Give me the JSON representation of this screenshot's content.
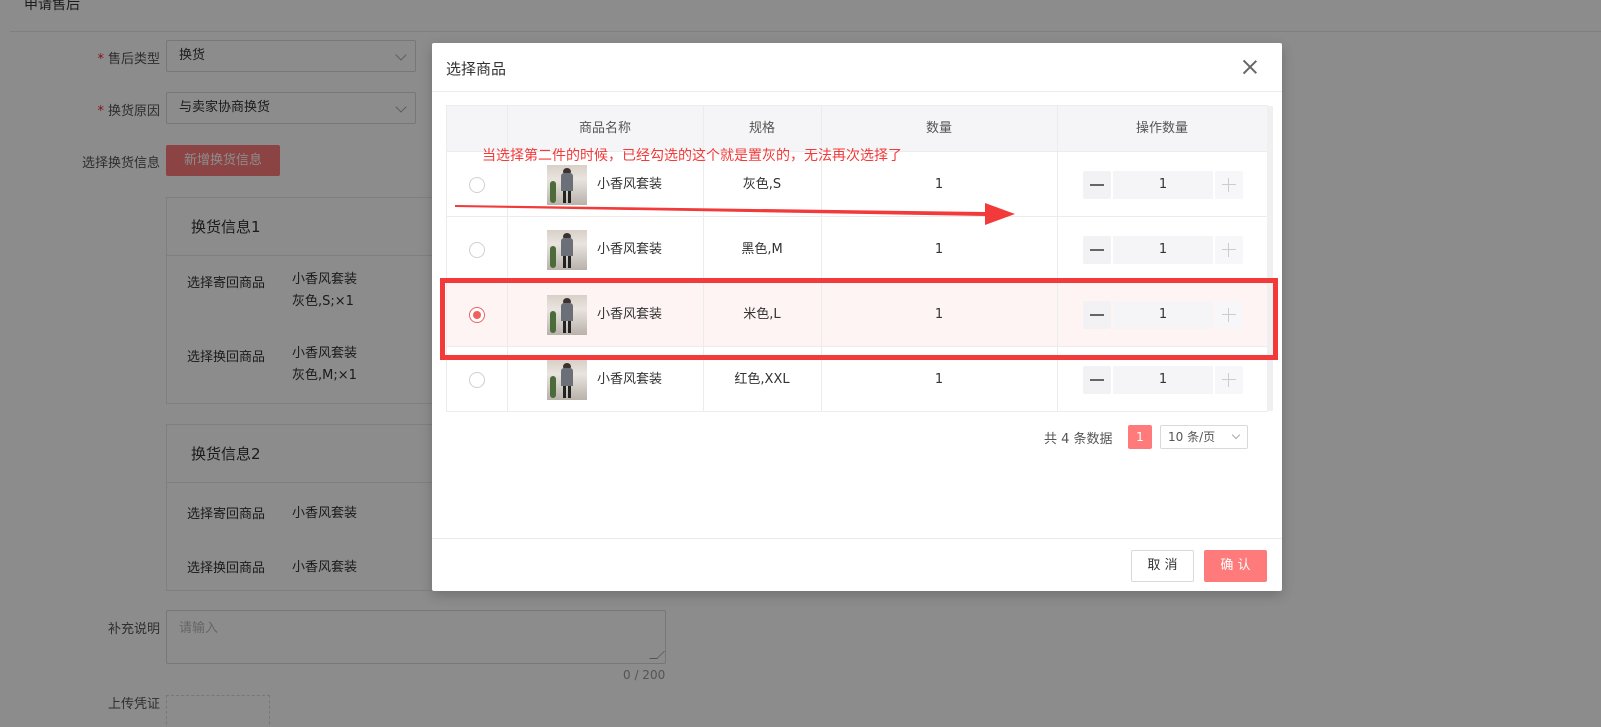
{
  "background": {
    "header_title": "申请售后",
    "form": {
      "type_label": "售后类型",
      "type_value": "换货",
      "reason_label": "换货原因",
      "reason_value": "与卖家协商换货",
      "select_info_label": "选择换货信息",
      "add_button": "新增换货信息",
      "cards": [
        {
          "title": "换货信息1",
          "return_label": "选择寄回商品",
          "return_name": "小香风套装",
          "return_spec": "灰色,S;×1",
          "exchange_label": "选择换回商品",
          "exchange_name": "小香风套装",
          "exchange_spec": "灰色,M;×1"
        },
        {
          "title": "换货信息2",
          "return_label": "选择寄回商品",
          "return_name": "小香风套装",
          "exchange_label": "选择换回商品",
          "exchange_name": "小香风套装"
        }
      ],
      "remark_label": "补充说明",
      "remark_placeholder": "请输入",
      "remark_counter": "0 / 200",
      "upload_label": "上传凭证"
    }
  },
  "modal": {
    "title": "选择商品",
    "columns": [
      "商品名称",
      "规格",
      "数量",
      "操作数量"
    ],
    "rows": [
      {
        "name": "小香风套装",
        "spec": "灰色,S",
        "qty": "1",
        "op_qty": "1",
        "selected": false
      },
      {
        "name": "小香风套装",
        "spec": "黑色,M",
        "qty": "1",
        "op_qty": "1",
        "selected": false
      },
      {
        "name": "小香风套装",
        "spec": "米色,L",
        "qty": "1",
        "op_qty": "1",
        "selected": true
      },
      {
        "name": "小香风套装",
        "spec": "红色,XXL",
        "qty": "1",
        "op_qty": "1",
        "selected": false
      }
    ],
    "pagination": {
      "total": "共 4 条数据",
      "current_page": "1",
      "page_size": "10 条/页"
    },
    "cancel_label": "取 消",
    "confirm_label": "确 认"
  },
  "annotation": {
    "text": "当选择第二件的时候，已经勾选的这个就是置灰的，无法再次选择了",
    "color": "#f23a3a"
  },
  "colors": {
    "accent": "#ff7b7b",
    "radio_checked": "#f06060",
    "selected_row_bg": "#fff4f4"
  }
}
